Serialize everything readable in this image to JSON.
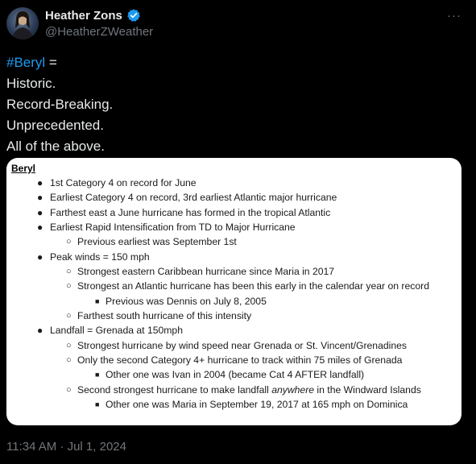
{
  "author": {
    "display_name": "Heather Zons",
    "handle": "@HeatherZWeather",
    "verified_color": "#1d9bf0"
  },
  "tweet": {
    "hashtag": "#Beryl",
    "hashtag_suffix": " =",
    "lines": [
      "Historic.",
      "Record-Breaking.",
      "Unprecedented.",
      "All of the above."
    ],
    "timestamp": "11:34 AM · Jul 1, 2024"
  },
  "media": {
    "title": "Beryl",
    "bullets": [
      {
        "level": 1,
        "text": "1st Category 4 on record for June"
      },
      {
        "level": 1,
        "text": "Earliest Category 4 on record, 3rd earliest Atlantic major hurricane"
      },
      {
        "level": 1,
        "text": "Farthest east a June hurricane has formed in the tropical Atlantic"
      },
      {
        "level": 1,
        "text": "Earliest Rapid Intensification from TD to Major Hurricane"
      },
      {
        "level": 2,
        "text": "Previous earliest was September 1st"
      },
      {
        "level": 1,
        "text": "Peak winds = 150 mph"
      },
      {
        "level": 2,
        "text": "Strongest eastern Caribbean hurricane since Maria in 2017"
      },
      {
        "level": 2,
        "text": "Strongest an Atlantic hurricane has been this early in the calendar year on record"
      },
      {
        "level": 3,
        "text": "Previous was Dennis on July 8, 2005"
      },
      {
        "level": 2,
        "text": "Farthest south hurricane of this intensity"
      },
      {
        "level": 1,
        "text": "Landfall = Grenada at 150mph"
      },
      {
        "level": 2,
        "text": "Strongest hurricane by wind speed near Grenada or St. Vincent/Grenadines"
      },
      {
        "level": 2,
        "text": "Only the second Category 4+ hurricane to track within 75 miles of Grenada"
      },
      {
        "level": 3,
        "text": "Other one was Ivan in 2004 (became Cat 4 AFTER landfall)"
      },
      {
        "level": 2,
        "text_before": "Second strongest hurricane to make landfall ",
        "text_italic": "anywhere",
        "text_after": " in the Windward Islands"
      },
      {
        "level": 3,
        "text": "Other one was Maria in September 19, 2017 at 165 mph on Dominica"
      }
    ]
  },
  "icons": {
    "verified": "verified-badge-icon",
    "more": "more-options-icon"
  }
}
